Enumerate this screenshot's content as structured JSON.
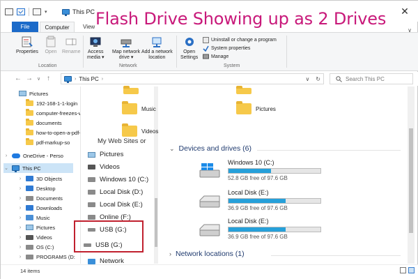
{
  "overlay_title": "Flash Drive Showing up as 2 Drives",
  "window": {
    "title": "This PC",
    "close_glyph": "✕",
    "collapse_glyph": "∨"
  },
  "ribbon": {
    "tabs": [
      {
        "label": "File"
      },
      {
        "label": "Computer"
      },
      {
        "label": "View"
      }
    ],
    "location_group": "Location",
    "network_group": "Network",
    "system_group": "System",
    "properties": "Properties",
    "open": "Open",
    "rename": "Rename",
    "access_media_1": "Access",
    "access_media_2": "media ▾",
    "map_drive_1": "Map network",
    "map_drive_2": "drive ▾",
    "add_location_1": "Add a network",
    "add_location_2": "location",
    "open_settings_1": "Open",
    "open_settings_2": "Settings",
    "uninstall": "Uninstall or change a program",
    "system_properties": "System properties",
    "manage": "Manage"
  },
  "address": {
    "path": "This PC",
    "back": "←",
    "forward": "→",
    "down": "∨",
    "up": "↑",
    "dropdown": "∨",
    "refresh": "↻"
  },
  "search": {
    "placeholder": "Search This PC",
    "icon": "search-icon"
  },
  "nav_pane": {
    "quick_access": [
      {
        "label": "Pictures",
        "icon": "pictures-icon",
        "pinned": true
      },
      {
        "label": "192-168-1-1-login",
        "icon": "folder-icon"
      },
      {
        "label": "computer-freezes-when-c",
        "icon": "folder-icon"
      },
      {
        "label": "documents",
        "icon": "folder-icon"
      },
      {
        "label": "how-to-open-a-pdf-in-we",
        "icon": "folder-icon"
      },
      {
        "label": "pdf-markup-so",
        "icon": "folder-icon"
      }
    ],
    "pin_glyph": "📌",
    "onedrive": "OneDrive - Perso",
    "this_pc": "This PC",
    "this_pc_children": [
      {
        "label": "3D Objects",
        "icon": "3d-objects-icon"
      },
      {
        "label": "Desktop",
        "icon": "desktop-icon"
      },
      {
        "label": "Documents",
        "icon": "documents-icon"
      },
      {
        "label": "Downloads",
        "icon": "downloads-icon"
      },
      {
        "label": "Music",
        "icon": "music-icon"
      },
      {
        "label": "Pictures",
        "icon": "pictures-icon"
      },
      {
        "label": "Videos",
        "icon": "videos-icon"
      },
      {
        "label": "OS (C:)",
        "icon": "drive-icon"
      },
      {
        "label": "PROGRAMS (D:",
        "icon": "drive-icon"
      }
    ]
  },
  "mid_panel": {
    "cut_text": "My Web Sites or",
    "items": [
      {
        "label": "Pictures",
        "icon": "pictures-icon"
      },
      {
        "label": "Videos",
        "icon": "videos-icon"
      },
      {
        "label": "Windows 10 (C:)",
        "icon": "drive-icon"
      },
      {
        "label": "Local Disk (D:)",
        "icon": "drive-icon"
      },
      {
        "label": "Local Disk (E:)",
        "icon": "drive-icon"
      },
      {
        "label": "Online (F:)",
        "icon": "drive-icon"
      },
      {
        "label": "USB (G:)",
        "icon": "usb-drive-icon"
      },
      {
        "label": "USB (G:)",
        "icon": "usb-drive-icon"
      },
      {
        "label": "Network",
        "icon": "network-icon"
      }
    ]
  },
  "content": {
    "folders": [
      {
        "label": "Music",
        "icon": "music-folder-icon"
      },
      {
        "label": "Pictures",
        "icon": "pictures-folder-icon"
      },
      {
        "label": "Videos",
        "icon": "videos-folder-icon"
      }
    ],
    "devices_header": "Devices and drives (6)",
    "drives": [
      {
        "name": "Windows 10 (C:)",
        "free_text": "52.8 GB free of 97.6 GB",
        "used_fraction": 0.46,
        "icon": "windows-drive-icon"
      },
      {
        "name": "Local Disk (E:)",
        "free_text": "36.9 GB free of 97.6 GB",
        "used_fraction": 0.62,
        "icon": "hard-drive-icon"
      },
      {
        "name": "Local Disk (E:)",
        "free_text": "36.9 GB free of 97.6 GB",
        "used_fraction": 0.62,
        "icon": "hard-drive-icon"
      }
    ],
    "network_header": "Network locations (1)"
  },
  "status": {
    "items_count": "14 items"
  },
  "colors": {
    "title_accent": "#c8197a",
    "red_box": "#c0202e",
    "file_tab": "#1b6ac9",
    "drive_bar": "#26a0da",
    "selection": "#cce4f7"
  }
}
